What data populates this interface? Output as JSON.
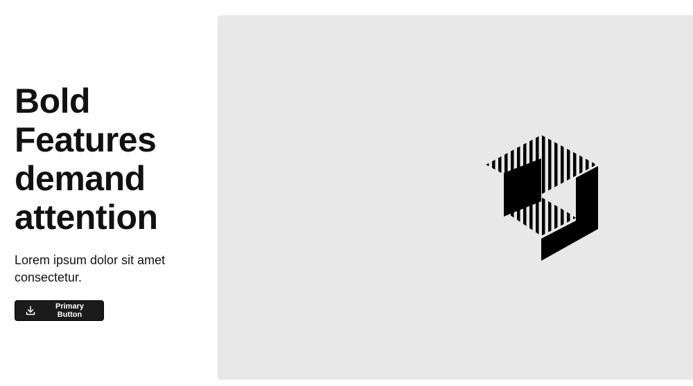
{
  "hero": {
    "title_lines": [
      "Bold",
      "Features",
      "demand",
      "attention"
    ],
    "subtitle": "Lorem ipsum dolor sit amet consectetur.",
    "primary_button": {
      "label": "Primary Button",
      "icon": "download-icon"
    }
  },
  "media": {
    "background_color": "#e8e8e8",
    "logo_icon": "striped-cube-logo-icon"
  },
  "colors": {
    "text": "#111111",
    "button_background": "#1b1b1b",
    "button_text": "#ffffff"
  }
}
